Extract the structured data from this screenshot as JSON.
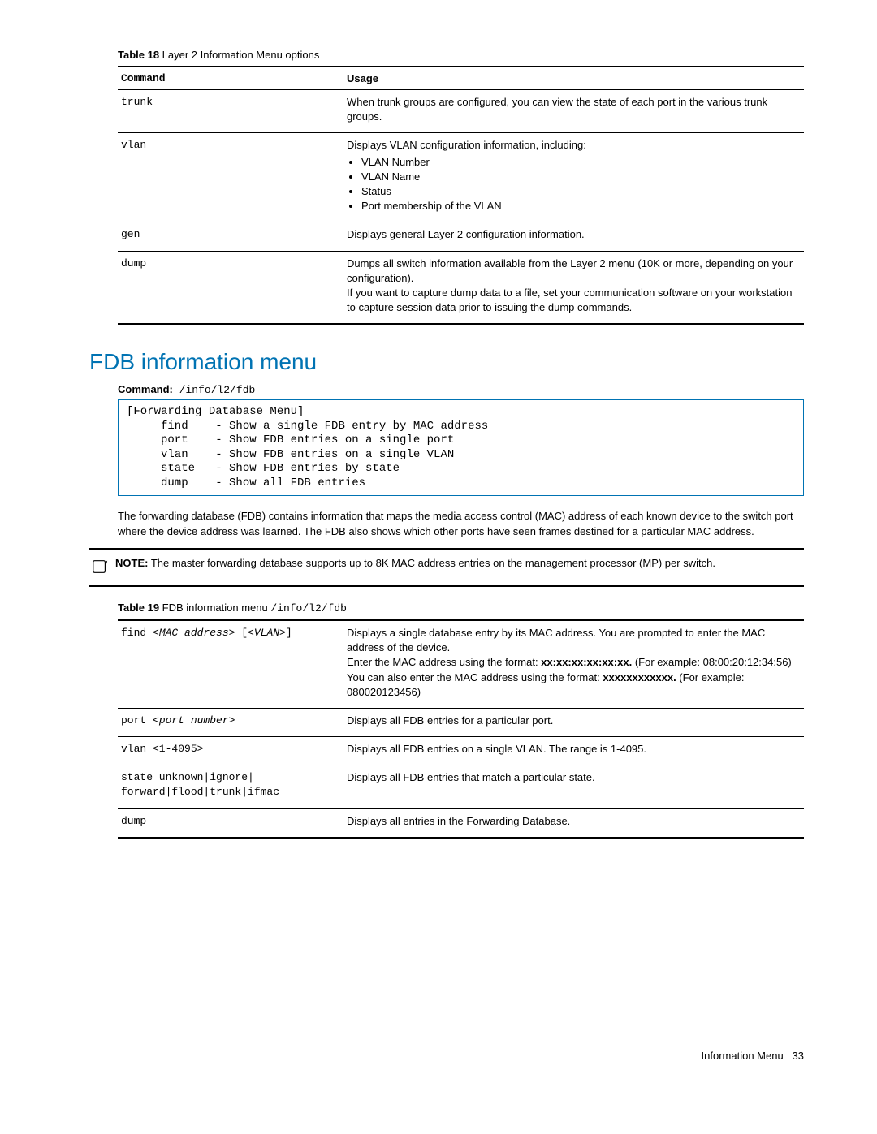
{
  "table18": {
    "caption_num": "Table 18",
    "caption_text": " Layer 2 Information Menu options",
    "headers": {
      "cmd": "Command",
      "usage": "Usage"
    },
    "rows": {
      "trunk": {
        "cmd": "trunk",
        "usage": "When trunk groups are configured, you can view the state of each port in the various trunk groups."
      },
      "vlan": {
        "cmd": "vlan",
        "usage_intro": "Displays VLAN configuration information, including:",
        "bullets": [
          "VLAN Number",
          "VLAN Name",
          "Status",
          "Port membership of the VLAN"
        ]
      },
      "gen": {
        "cmd": "gen",
        "usage": "Displays general Layer 2 configuration information."
      },
      "dump": {
        "cmd": "dump",
        "usage_a": "Dumps all switch information available from the Layer 2 menu (10K or more, depending on your configuration).",
        "usage_b": "If you want to capture dump data to a file, set your communication software on your workstation to capture session data prior to issuing the dump commands."
      }
    }
  },
  "section_heading": "FDB information menu",
  "command_label": "Command:",
  "command_path": " /info/l2/fdb",
  "code_block": "[Forwarding Database Menu]\n     find    - Show a single FDB entry by MAC address\n     port    - Show FDB entries on a single port\n     vlan    - Show FDB entries on a single VLAN\n     state   - Show FDB entries by state\n     dump    - Show all FDB entries",
  "para1": "The forwarding database (FDB) contains information that maps the media access control (MAC) address of each known device to the switch port where the device address was learned. The FDB also shows which other ports have seen frames destined for a particular MAC address.",
  "note": {
    "label": "NOTE:",
    "text": "  The master forwarding database supports up to 8K MAC address entries on the management processor (MP) per switch."
  },
  "table19": {
    "caption_num": "Table 19",
    "caption_text": " FDB information menu ",
    "caption_code": "/info/l2/fdb",
    "rows": {
      "find": {
        "cmd_a": "find ",
        "cmd_b": "<MAC address>",
        "cmd_c": " [",
        "cmd_d": "<VLAN>",
        "cmd_e": "]",
        "u1": "Displays a single database entry by its MAC address. You are prompted to enter the MAC address of the device.",
        "u2a": "Enter the MAC address using the format: ",
        "u2b": "xx:xx:xx:xx:xx:xx.",
        "u2c": " (For example: 08:00:20:12:34:56)",
        "u3a": "You can also enter the MAC address using the format: ",
        "u3b": "xxxxxxxxxxxx.",
        "u3c": " (For example: 080020123456)"
      },
      "port": {
        "cmd_a": "port ",
        "cmd_b": "<port number>",
        "usage": "Displays all FDB entries for a particular port."
      },
      "vlan": {
        "cmd": "vlan <1-4095>",
        "usage": "Displays all FDB entries on a single VLAN. The range is 1-4095."
      },
      "state": {
        "cmd": "state unknown|ignore|\nforward|flood|trunk|ifmac",
        "usage": "Displays all FDB entries that match a particular state."
      },
      "dump": {
        "cmd": "dump",
        "usage": "Displays all entries in the Forwarding Database."
      }
    }
  },
  "footer": {
    "label": "Information Menu",
    "page": "33"
  }
}
